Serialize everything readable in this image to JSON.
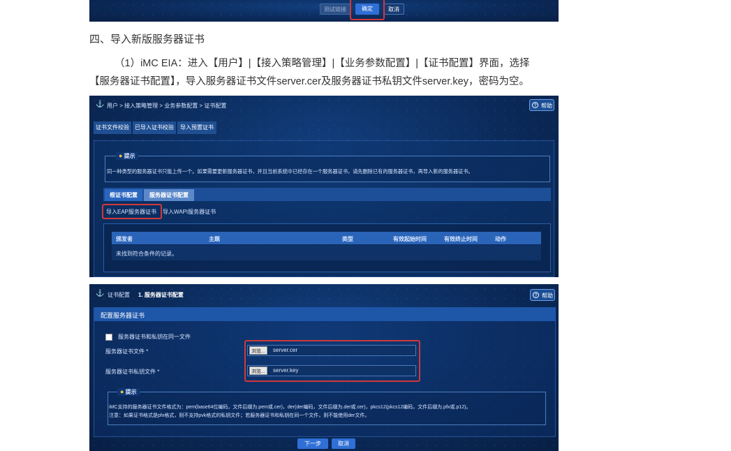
{
  "section_heading": "四、导入新版服务器证书",
  "paragraph_line1": "（1）iMC EIA：进入【用户】|【接入策略管理】|【业务参数配置】|【证书配置】界面，选择",
  "paragraph_line2": "【服务器证书配置】，导入服务器证书文件server.cer及服务器证书私钥文件server.key，密码为空。",
  "top_shot": {
    "test_link_label": "测试链接",
    "ok_label": "确定",
    "cancel_label": "取消"
  },
  "shot1": {
    "breadcrumb": "用户 > 接入策略管理 > 业务参数配置 > 证书配置",
    "help_label": "帮助",
    "toolbar_tabs": [
      "证书文件校验",
      "已导入证书校验",
      "导入预置证书"
    ],
    "tip_title": "提示",
    "tip_text": "同一种类型的服务器证书只能上传一个。如果需要更新服务器证书，并且当前系统中已经存在一个服务器证书，请先删除已有的服务器证书，再导入新的服务器证书。",
    "cert_tabs": [
      "根证书配置",
      "服务器证书配置"
    ],
    "import_eap_label": "导入EAP服务器证书",
    "import_wapi_label": "导入WAPI服务器证书",
    "table_columns": [
      "颁发者",
      "主题",
      "类型",
      "有效起始时间",
      "有效终止时间",
      "动作"
    ],
    "empty_row_text": "未找到符合条件的记录。"
  },
  "shot2": {
    "breadcrumb_prefix": "证书配置",
    "breadcrumb_current": "1. 服务器证书配置",
    "help_label": "帮助",
    "panel_title": "配置服务器证书",
    "same_file_checkbox_label": "服务器证书和私钥在同一文件",
    "cert_file_label": "服务器证书文件 *",
    "key_file_label": "服务器证书私钥文件 *",
    "browse_label": "浏览...",
    "cert_file_value": "server.cer",
    "key_file_value": "server.key",
    "tip_title": "提示",
    "tip_line1": "iMC支持的服务器证书文件格式为：pem(base64位编码，文件后缀为.pem或.cer)，der(der编码，文件后缀为.der或.cer)，pkcs12(pkcs12编码，文件后缀为.pfx或.p12)。",
    "tip_line2": "注意：如果证书格式是pfx格式，则不支持pvk格式的私钥文件；若服务器证书和私钥在同一个文件，则不能使用der文件。",
    "next_label": "下一步",
    "cancel_label": "取消"
  },
  "colors": {
    "ui_bg": "#0b2a5a",
    "highlight_red": "#d0393a",
    "primary_button": "#2f6fd6",
    "table_header": "#2a64b8"
  }
}
